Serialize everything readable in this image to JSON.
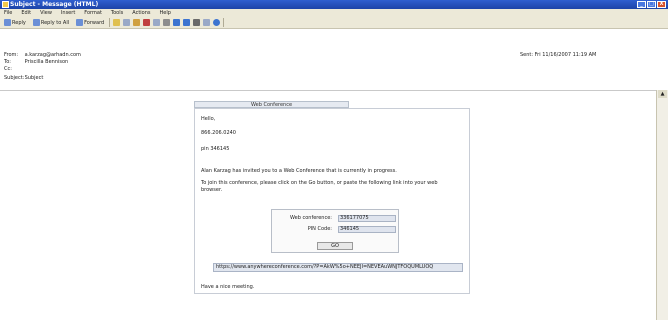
{
  "window": {
    "title": "Subject - Message (HTML)",
    "minimize_label": "_",
    "maximize_label": "□",
    "close_label": "X"
  },
  "menu": [
    "File",
    "Edit",
    "View",
    "Insert",
    "Format",
    "Tools",
    "Actions",
    "Help"
  ],
  "toolbar": {
    "reply": "Reply",
    "reply_all": "Reply to All",
    "forward": "Forward"
  },
  "header": {
    "from_label": "From:",
    "from_value": "a.karzag@arhadn.com",
    "to_label": "To:",
    "to_value": "Priscilla Bennison",
    "cc_label": "Cc:",
    "cc_value": "",
    "subject_label": "Subject:",
    "subject_value": "Subject",
    "sent_label": "Sent:",
    "sent_value": "Fri 11/16/2007 11:19 AM"
  },
  "conference": {
    "tab_title": "Web Conference",
    "greeting": "Hello,",
    "phone": "866.206.0240",
    "pin_line": "pin 346145",
    "invite": "Alan Karzag has invited you to a Web Conference that is currently in progress.",
    "join_line1": "To join this conference, please click on the Go button, or paste the following link into your web",
    "join_line2": "browser.",
    "web_conf_label": "Web conference:",
    "web_conf_value": "336177075",
    "pin_code_label": "PIN Code:",
    "pin_code_value": "346145",
    "go_label": "GO",
    "link": "https://www.anywhereconference.com/?P=AkW%5o+NEEJI=NEVEAuWNJTFOQUMLUOQ",
    "closing": "Have a nice meeting."
  },
  "colors": {
    "title_bar": "#1d43a8",
    "chrome": "#ece9d8",
    "input_fill": "#dfe4ee"
  }
}
